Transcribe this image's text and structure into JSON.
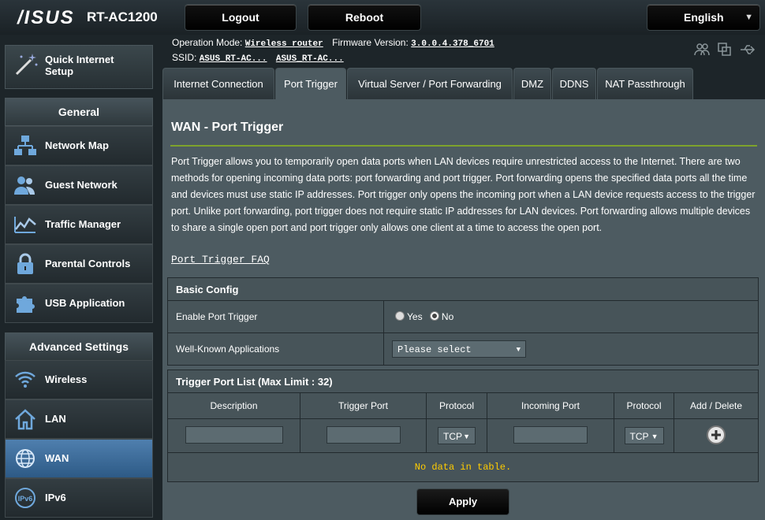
{
  "header": {
    "brand": "/ISUS",
    "model": "RT-AC1200",
    "logout_label": "Logout",
    "reboot_label": "Reboot",
    "language": "English"
  },
  "info": {
    "op_mode_label": "Operation Mode:",
    "op_mode_value": "Wireless router",
    "fw_label": "Firmware Version:",
    "fw_value": "3.0.0.4.378_6701",
    "ssid_label": "SSID:",
    "ssid1": "ASUS_RT-AC...",
    "ssid2": "ASUS_RT-AC..."
  },
  "sidebar": {
    "qis_line1": "Quick Internet",
    "qis_line2": "Setup",
    "general_title": "General",
    "general_items": [
      {
        "label": "Network Map",
        "icon": "network-map-icon"
      },
      {
        "label": "Guest Network",
        "icon": "guest-network-icon"
      },
      {
        "label": "Traffic Manager",
        "icon": "traffic-manager-icon"
      },
      {
        "label": "Parental Controls",
        "icon": "lock-icon"
      },
      {
        "label": "USB Application",
        "icon": "puzzle-icon"
      }
    ],
    "advanced_title": "Advanced Settings",
    "advanced_items": [
      {
        "label": "Wireless",
        "icon": "wifi-icon"
      },
      {
        "label": "LAN",
        "icon": "home-icon"
      },
      {
        "label": "WAN",
        "icon": "globe-icon",
        "active": true
      },
      {
        "label": "IPv6",
        "icon": "ipv6-icon"
      }
    ]
  },
  "tabs": [
    {
      "label": "Internet Connection"
    },
    {
      "label": "Port Trigger",
      "active": true
    },
    {
      "label": "Virtual Server / Port Forwarding"
    },
    {
      "label": "DMZ"
    },
    {
      "label": "DDNS"
    },
    {
      "label": "NAT Passthrough"
    }
  ],
  "main": {
    "title": "WAN - Port Trigger",
    "description": "Port Trigger allows you to temporarily open data ports when LAN devices require unrestricted access to the Internet. There are two methods for opening incoming data ports: port forwarding and port trigger. Port forwarding opens the specified data ports all the time and devices must use static IP addresses. Port trigger only opens the incoming port when a LAN device requests access to the trigger port. Unlike port forwarding, port trigger does not require static IP addresses for LAN devices. Port forwarding allows multiple devices to share a single open port and port trigger only allows one client at a time to access the open port.",
    "faq_link": "Port Trigger FAQ"
  },
  "basic_config": {
    "title": "Basic Config",
    "enable_label": "Enable Port Trigger",
    "yes_label": "Yes",
    "no_label": "No",
    "selected": "No",
    "apps_label": "Well-Known Applications",
    "apps_value": "Please select"
  },
  "trigger_list": {
    "title": "Trigger Port List (Max Limit : 32)",
    "columns": [
      "Description",
      "Trigger Port",
      "Protocol",
      "Incoming Port",
      "Protocol",
      "Add / Delete"
    ],
    "protocol1": "TCP",
    "protocol2": "TCP",
    "empty_text": "No data in table."
  },
  "apply_label": "Apply",
  "colors": {
    "accent_green": "#7ea22c",
    "active_nav": "#3e6c9a",
    "empty_text": "#ffcc00"
  }
}
